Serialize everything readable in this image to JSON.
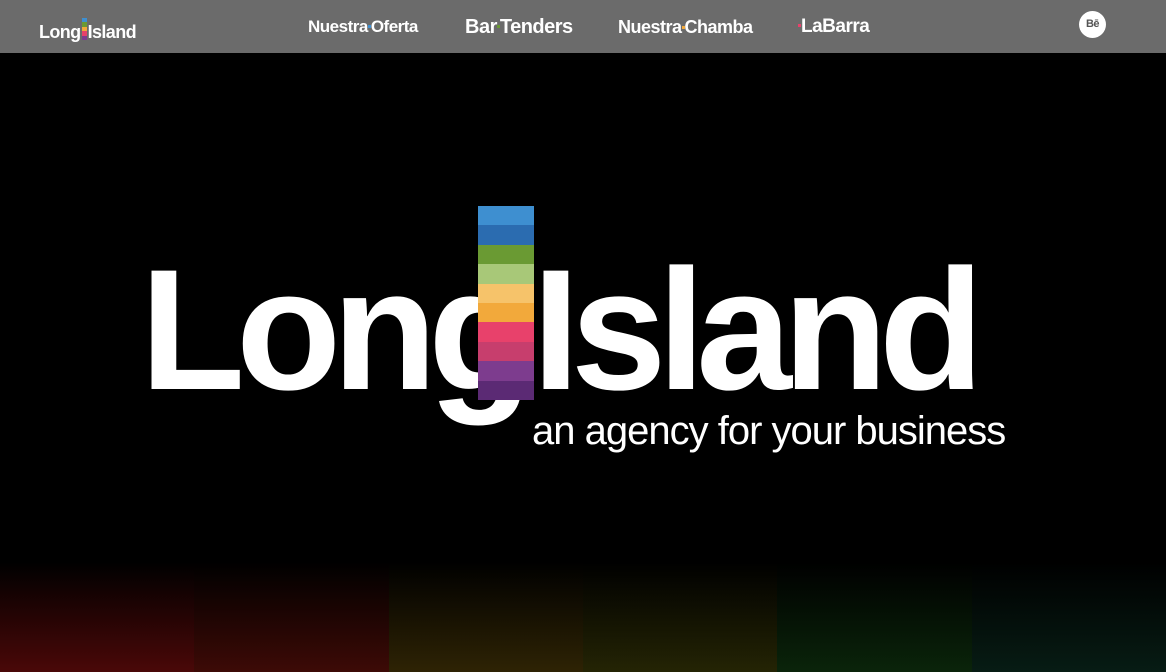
{
  "brand": {
    "logo_left": "Long",
    "logo_right": "Island",
    "tagline": "an agency for your business",
    "stripe_colors": [
      "#3e8fd0",
      "#2b6cb0",
      "#6a9a33",
      "#a8c878",
      "#f6c36a",
      "#f2a93b",
      "#e8416b",
      "#c73e6d",
      "#7d3c8e",
      "#5b2a74"
    ]
  },
  "nav": {
    "logo_left": "Long",
    "logo_right": "Island",
    "links": [
      {
        "pre": "Nuestra",
        "post": "Oferta"
      },
      {
        "pre": "Bar",
        "post": "Tenders"
      },
      {
        "pre": "Nuestra",
        "post": "Chamba"
      },
      {
        "pre": "",
        "post": "LaBarra"
      }
    ],
    "link_square_colors": [
      "#3e8fd0",
      "#6a9a33",
      "#f2a93b",
      "#e8416b"
    ],
    "behance_label": "Bē"
  },
  "colors": {
    "navbar_bg": "#6b6b6b",
    "page_bg": "#000000",
    "text": "#ffffff",
    "glow": [
      "#5a0a0a",
      "#4a0f05",
      "#3a2a05",
      "#2a2a05",
      "#0a2a0a",
      "#082018"
    ]
  }
}
